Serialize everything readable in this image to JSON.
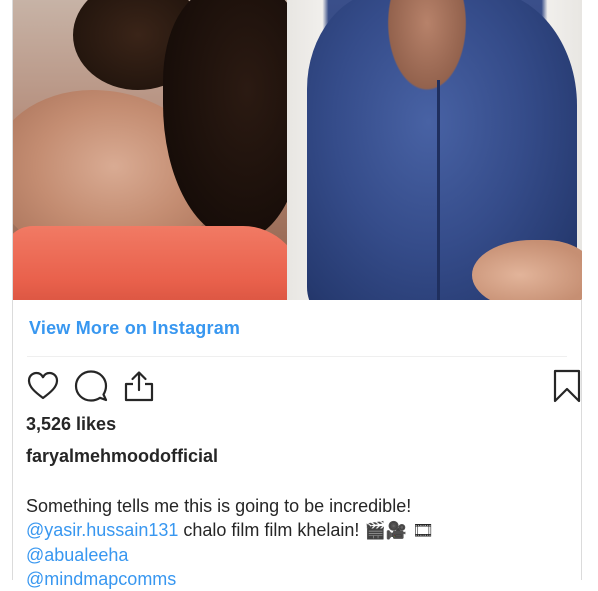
{
  "post": {
    "view_more_label": "View More on Instagram",
    "likes_text": "3,526 likes",
    "username": "faryalmehmoodofficial",
    "caption": {
      "line1": "Something tells me this is going to be incredible!",
      "mention1": "@yasir.hussain131",
      "line2_text": " chalo film film khelain! ",
      "line2_emoji": "🎬🎥 🎞",
      "mention2": "@abualeeha",
      "mention3": "@mindmapcomms"
    }
  },
  "icons": {
    "like": "heart-icon",
    "comment": "comment-icon",
    "share": "share-icon",
    "save": "bookmark-icon"
  },
  "colors": {
    "link": "#3897f0",
    "text": "#262626",
    "border": "#dbdbdb"
  }
}
